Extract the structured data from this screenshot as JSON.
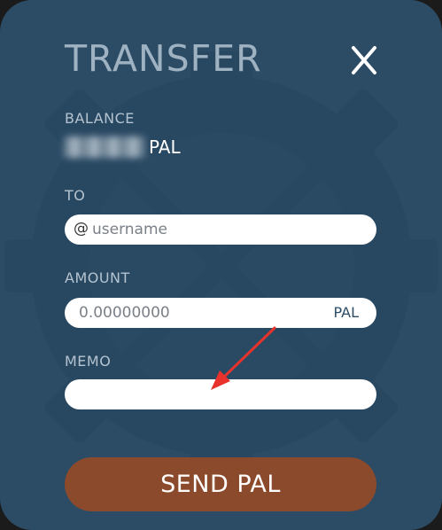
{
  "dialog": {
    "title": "TRANSFER",
    "close_label": "X"
  },
  "balance": {
    "label": "BALANCE",
    "amount_redacted": "",
    "unit": "PAL"
  },
  "to": {
    "label": "TO",
    "prefix": "@",
    "placeholder": "username",
    "value": ""
  },
  "amount": {
    "label": "AMOUNT",
    "placeholder": "0.00000000",
    "value": "",
    "unit": "PAL"
  },
  "memo": {
    "label": "MEMO",
    "placeholder": "",
    "value": ""
  },
  "send_button": {
    "label": "SEND PAL"
  },
  "colors": {
    "panel_bg": "#2c4c66",
    "title": "#9fb2c2",
    "button_bg": "#8b4a2c",
    "annotation_arrow": "#e8322b"
  },
  "icons": [
    "close-icon",
    "logo-watermark-icon",
    "annotation-arrow-icon"
  ]
}
